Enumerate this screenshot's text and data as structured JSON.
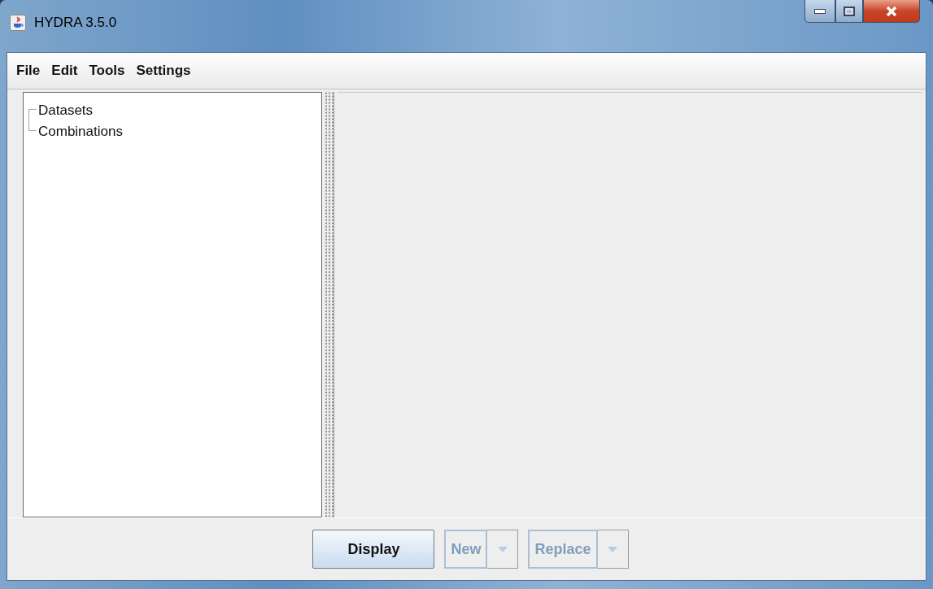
{
  "window": {
    "title": "HYDRA 3.5.0"
  },
  "menu": [
    "File",
    "Edit",
    "Tools",
    "Settings"
  ],
  "tree": {
    "children": [
      {
        "label": "Datasets"
      },
      {
        "label": "Combinations"
      }
    ]
  },
  "buttons": [
    {
      "label": "Display",
      "kind": "plain",
      "disabled": false
    },
    {
      "label": "New",
      "kind": "split",
      "disabled": true
    },
    {
      "label": "Replace",
      "kind": "split",
      "disabled": true
    }
  ]
}
